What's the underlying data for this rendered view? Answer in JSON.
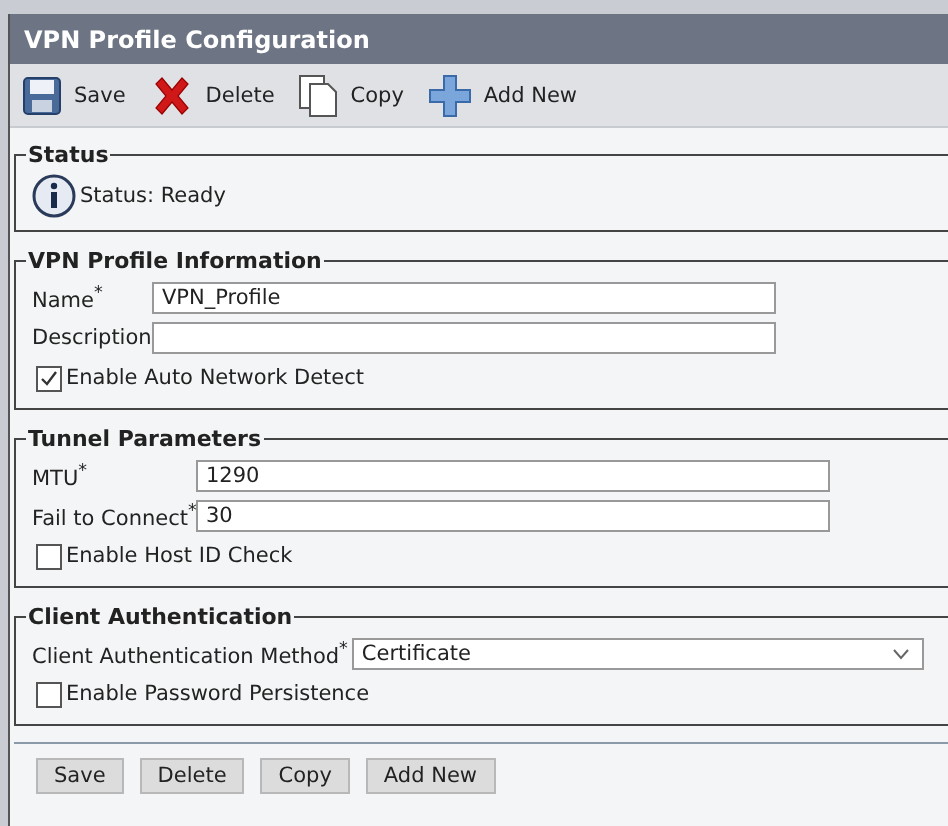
{
  "window": {
    "title": "VPN Profile Configuration"
  },
  "toolbar": [
    {
      "kind": "save",
      "label": "Save"
    },
    {
      "kind": "delete",
      "label": "Delete"
    },
    {
      "kind": "copy",
      "label": "Copy"
    },
    {
      "kind": "add",
      "label": "Add New"
    }
  ],
  "status": {
    "legend": "Status",
    "text": "Status: Ready"
  },
  "sections": [
    {
      "legend": "VPN Profile Information",
      "rows": [
        {
          "kind": "text",
          "label": "Name$^{*}$",
          "value": "VPN_Profile"
        },
        {
          "kind": "text",
          "label": "Description"
        },
        {
          "kind": "checkbox",
          "label": "Enable Auto Network Detect",
          "checked": true
        }
      ]
    },
    {
      "legend": "Tunnel Parameters",
      "rows": [
        {
          "kind": "text",
          "label": "MTU$^{*}$",
          "value": "1290"
        },
        {
          "kind": "text",
          "label": "Fail to Connect$^{*}$",
          "value": "30"
        },
        {
          "kind": "checkbox",
          "label": "Enable Host ID Check",
          "checked": false
        }
      ]
    },
    {
      "legend": "Client Authentication",
      "rows": [
        {
          "kind": "select",
          "label": "Client Authentication Method$^{*}$",
          "value": "Certificate"
        },
        {
          "kind": "checkbox",
          "label": "Enable Password Persistence",
          "checked": false
        }
      ]
    }
  ],
  "buttons": [
    "Save",
    "Delete",
    "Copy",
    "Add New"
  ]
}
